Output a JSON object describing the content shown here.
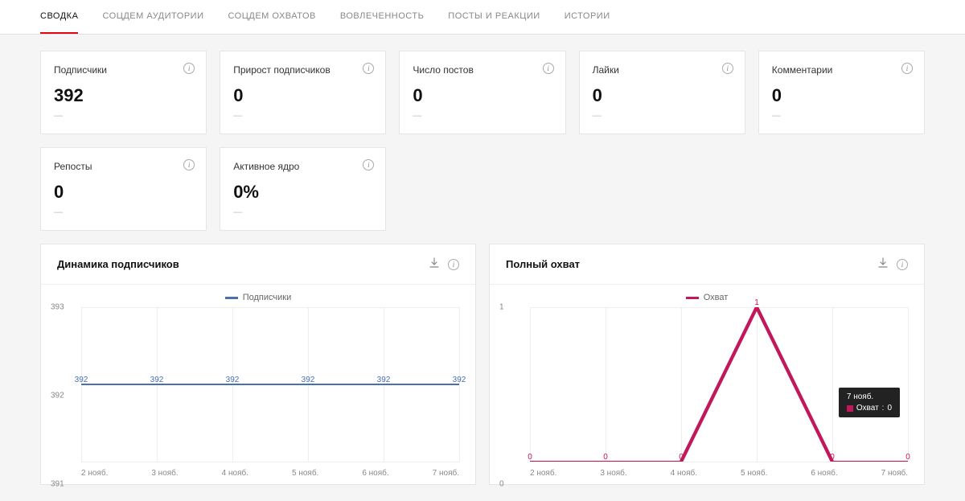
{
  "tabs": [
    "СВОДКА",
    "СОЦДЕМ АУДИТОРИИ",
    "СОЦДЕМ ОХВАТОВ",
    "ВОВЛЕЧЕННОСТЬ",
    "ПОСТЫ И РЕАКЦИИ",
    "ИСТОРИИ"
  ],
  "active_tab": 0,
  "cards": [
    {
      "title": "Подписчики",
      "value": "392",
      "delta": "—"
    },
    {
      "title": "Прирост подписчиков",
      "value": "0",
      "delta": "—"
    },
    {
      "title": "Число постов",
      "value": "0",
      "delta": "—"
    },
    {
      "title": "Лайки",
      "value": "0",
      "delta": "—"
    },
    {
      "title": "Комментарии",
      "value": "0",
      "delta": "—"
    },
    {
      "title": "Репосты",
      "value": "0",
      "delta": "—"
    },
    {
      "title": "Активное ядро",
      "value": "0%",
      "delta": "—"
    }
  ],
  "chart1": {
    "title": "Динамика подписчиков",
    "legend": "Подписчики",
    "color": "#4a6fb5",
    "tooltip": null
  },
  "chart2": {
    "title": "Полный охват",
    "legend": "Охват",
    "color": "#c2185b",
    "tooltip": {
      "date": "7 нояб.",
      "series": "Охват",
      "value": "0"
    }
  },
  "chart_data": [
    {
      "type": "line",
      "title": "Динамика подписчиков",
      "categories": [
        "2 нояб.",
        "3 нояб.",
        "4 нояб.",
        "5 нояб.",
        "6 нояб.",
        "7 нояб."
      ],
      "series": [
        {
          "name": "Подписчики",
          "values": [
            392,
            392,
            392,
            392,
            392,
            392
          ]
        }
      ],
      "ylim": [
        391,
        393
      ],
      "yticks": [
        391,
        392,
        393
      ]
    },
    {
      "type": "line",
      "title": "Полный охват",
      "categories": [
        "2 нояб.",
        "3 нояб.",
        "4 нояб.",
        "5 нояб.",
        "6 нояб.",
        "7 нояб."
      ],
      "series": [
        {
          "name": "Охват",
          "values": [
            0,
            0,
            0,
            1,
            0,
            0
          ]
        }
      ],
      "ylim": [
        0,
        1
      ],
      "yticks": [
        0,
        1
      ]
    }
  ]
}
